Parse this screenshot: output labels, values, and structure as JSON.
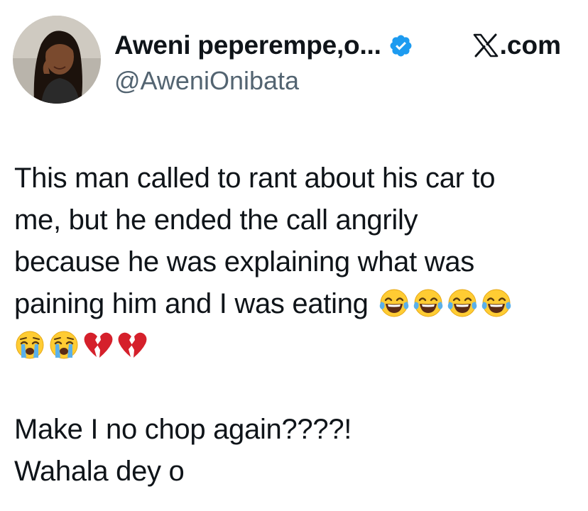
{
  "author": {
    "display_name": "Aweni peperempe,o...",
    "handle": "@AweniOnibata",
    "verified": true,
    "verified_color": "#1d9bf0"
  },
  "source": {
    "label": ".com",
    "icon": "x-logo-icon"
  },
  "tweet": {
    "line1": "This man called to rant about his car to",
    "line2": "me, but he ended the call angrily",
    "line3": "because he was explaining what was",
    "line4": "paining him and I was eating",
    "line4_emojis": [
      "tears-of-joy-emoji",
      "tears-of-joy-emoji",
      "tears-of-joy-emoji",
      "tears-of-joy-emoji"
    ],
    "line5_emojis": [
      "loudly-crying-emoji",
      "loudly-crying-emoji",
      "broken-heart-emoji",
      "broken-heart-emoji"
    ],
    "line6": "Make I no chop again????!",
    "line7": "Wahala dey o"
  },
  "colors": {
    "text": "#0f1419",
    "secondary_text": "#536471",
    "emoji_yellow": "#ffcc33",
    "emoji_tear": "#5ab0ea",
    "broken_heart": "#d5202b"
  }
}
